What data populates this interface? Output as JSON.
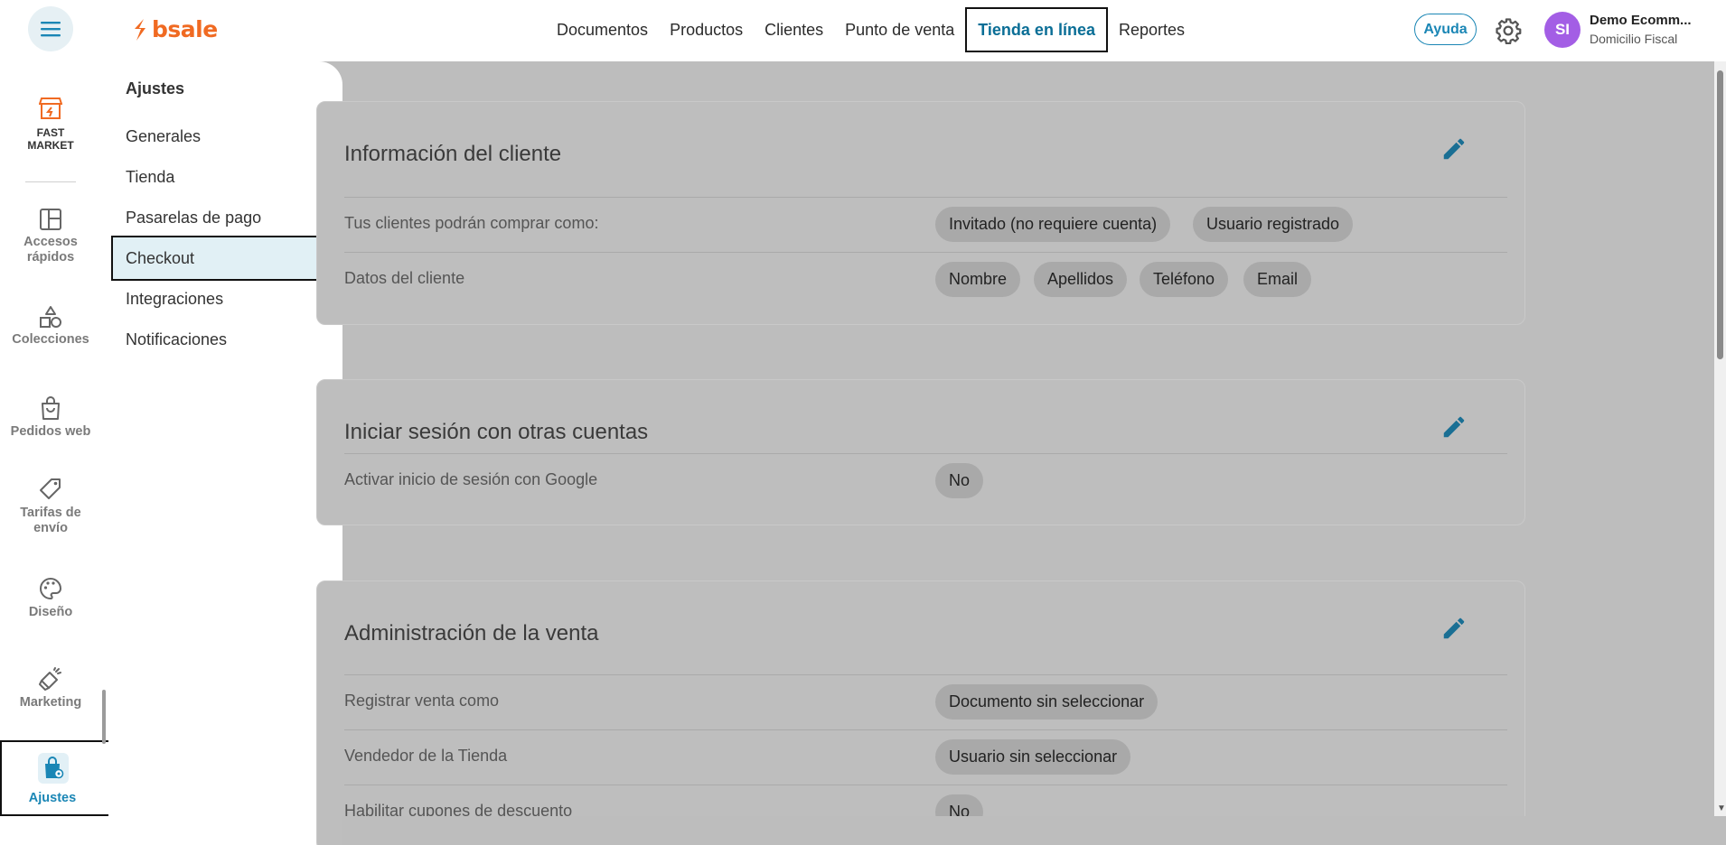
{
  "header": {
    "logo_text": "bsale",
    "nav": [
      "Documentos",
      "Productos",
      "Clientes",
      "Punto de venta",
      "Tienda en línea",
      "Reportes"
    ],
    "active_nav": "Tienda en línea",
    "help_label": "Ayuda",
    "avatar_initials": "SI",
    "user_name": "Demo Ecomm...",
    "user_sub": "Domicilio Fiscal"
  },
  "rail": {
    "store_name": "FAST MARKET",
    "items": [
      {
        "label": "Accesos rápidos",
        "icon": "layout-icon"
      },
      {
        "label": "Colecciones",
        "icon": "shapes-icon"
      },
      {
        "label": "Pedidos web",
        "icon": "bag-icon"
      },
      {
        "label": "Tarifas de envío",
        "icon": "tag-icon"
      },
      {
        "label": "Diseño",
        "icon": "palette-icon"
      },
      {
        "label": "Marketing",
        "icon": "megaphone-icon"
      }
    ],
    "active_label": "Ajustes"
  },
  "submenu": {
    "title": "Ajustes",
    "items": [
      "Generales",
      "Tienda",
      "Pasarelas de pago",
      "Checkout",
      "Integraciones",
      "Notificaciones"
    ],
    "active": "Checkout"
  },
  "cards": [
    {
      "title": "Información del cliente",
      "rows": [
        {
          "label": "Tus clientes podrán comprar como:",
          "chips": [
            "Invitado (no requiere cuenta)",
            "Usuario registrado"
          ]
        },
        {
          "label": "Datos del cliente",
          "chips": [
            "Nombre",
            "Apellidos",
            "Teléfono",
            "Email"
          ]
        }
      ]
    },
    {
      "title": "Iniciar sesión con otras cuentas",
      "rows": [
        {
          "label": "Activar inicio de sesión con Google",
          "chips": [
            "No"
          ]
        }
      ]
    },
    {
      "title": "Administración de la venta",
      "rows": [
        {
          "label": "Registrar venta como",
          "chips": [
            "Documento sin seleccionar"
          ]
        },
        {
          "label": "Vendedor de la Tienda",
          "chips": [
            "Usuario sin seleccionar"
          ]
        },
        {
          "label": "Habilitar cupones de descuento",
          "chips": [
            "No"
          ]
        }
      ]
    }
  ],
  "colors": {
    "accent": "#1a86b5",
    "brand": "#f06a22",
    "avatar": "#a35ee5"
  }
}
